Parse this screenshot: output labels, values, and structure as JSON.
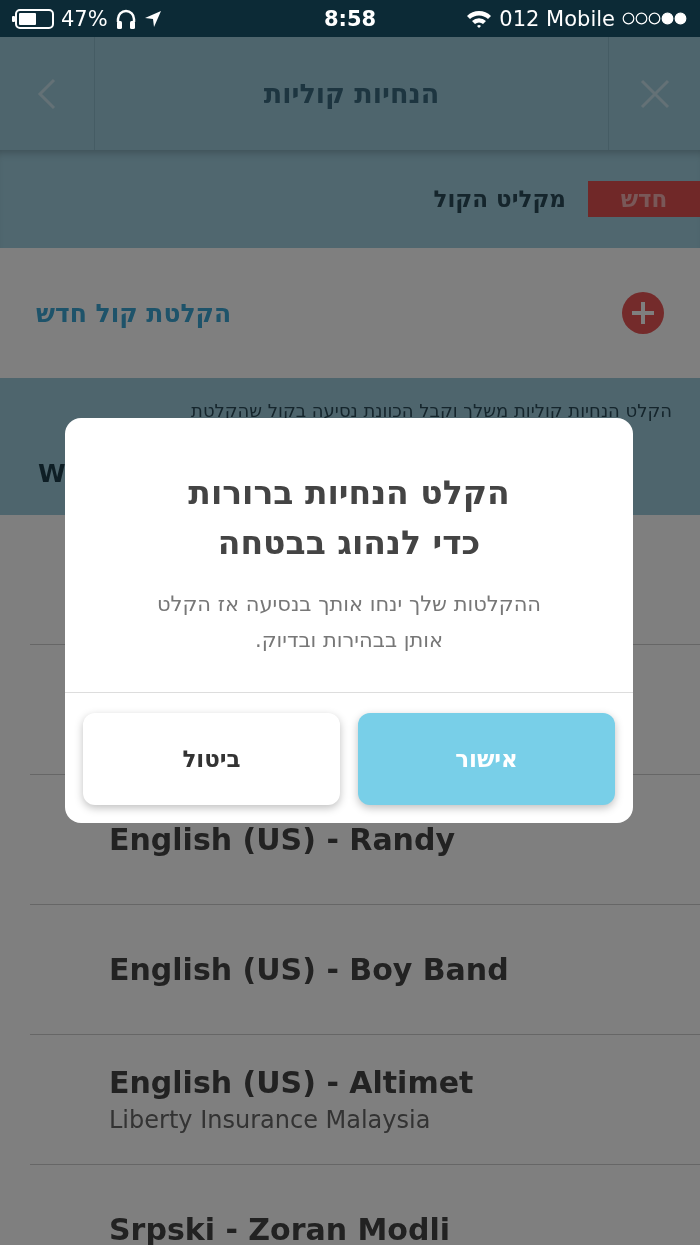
{
  "status_bar": {
    "battery": "47%",
    "time": "8:58",
    "carrier": "012 Mobile"
  },
  "nav": {
    "title": "הנחיות קוליות"
  },
  "recorder": {
    "badge": "חדש",
    "label": "מקליט הקול"
  },
  "new_recording": {
    "label": "הקלטת קול חדש"
  },
  "intro": {
    "text": "הקלט הנחיות קוליות משלך וקבל הכוונת נסיעה בקול שהקלטת",
    "section_header": "W"
  },
  "voices": [
    {
      "title": "English (US) - Randy"
    },
    {
      "title": "English (US) - Boy Band"
    },
    {
      "title": "English (US) - Altimet",
      "subtitle": "Liberty Insurance Malaysia"
    },
    {
      "title": "Srpski - Zoran Modli"
    }
  ],
  "dialog": {
    "title_lines": [
      "הקלט הנחיות ברורות",
      "כדי לנהוג בבטחה"
    ],
    "message": "ההקלטות שלך ינחו אותך בנסיעה אז הקלט אותן בבהירות ובדיוק.",
    "buttons": [
      {
        "label": "אישור",
        "kind": "primary"
      },
      {
        "label": "ביטול",
        "kind": "secondary"
      }
    ]
  }
}
